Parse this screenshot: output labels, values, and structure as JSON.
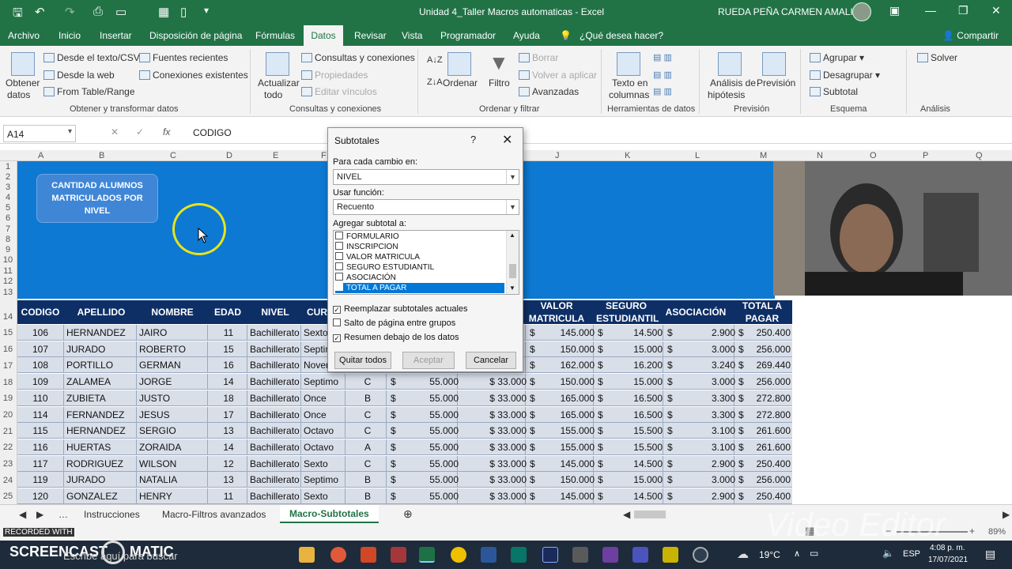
{
  "window": {
    "title": "Unidad 4_Taller Macros automaticas  -  Excel",
    "user": "RUEDA PEÑA CARMEN AMALIA"
  },
  "tabs": [
    "Archivo",
    "Inicio",
    "Insertar",
    "Disposición de página",
    "Fórmulas",
    "Datos",
    "Revisar",
    "Vista",
    "Programador",
    "Ayuda"
  ],
  "tell_me": "¿Qué desea hacer?",
  "share": "Compartir",
  "ribbon": {
    "obtener": "Obtener",
    "datos": "datos",
    "desde_texto": "Desde el texto/CSV",
    "desde_web": "Desde la web",
    "from_table": "From Table/Range",
    "fuentes": "Fuentes recientes",
    "conexiones_exist": "Conexiones existentes",
    "group1": "Obtener y transformar datos",
    "actualizar": "Actualizar",
    "todo": "todo",
    "consultas_con": "Consultas y conexiones",
    "propiedades": "Propiedades",
    "editar_vinculos": "Editar vínculos",
    "group2": "Consultas y conexiones",
    "ordenar": "Ordenar",
    "filtro": "Filtro",
    "borrar": "Borrar",
    "volver_aplicar": "Volver a aplicar",
    "avanzadas": "Avanzadas",
    "group3": "Ordenar y filtrar",
    "texto_en": "Texto en",
    "columnas": "columnas",
    "group4": "Herramientas de datos",
    "analisis": "Análisis de",
    "hipotesis": "hipótesis",
    "prevision": "Previsión",
    "group5": "Previsión",
    "agrupar": "Agrupar",
    "desagrupar": "Desagrupar",
    "subtotal": "Subtotal",
    "group6": "Esquema",
    "solver": "Solver",
    "group7": "Análisis"
  },
  "formula": {
    "namebox": "A14",
    "fx": "fx",
    "value": "CODIGO"
  },
  "columns": [
    "A",
    "B",
    "C",
    "D",
    "E",
    "F",
    "J",
    "K",
    "L",
    "M",
    "N",
    "O",
    "P",
    "Q"
  ],
  "rows_hdr": [
    "1",
    "2",
    "3",
    "4",
    "5",
    "6",
    "7",
    "8",
    "9",
    "10",
    "11",
    "12",
    "13",
    "14",
    "15",
    "16",
    "17",
    "18",
    "19",
    "20",
    "21",
    "22",
    "23",
    "24",
    "25"
  ],
  "banner": [
    "CANTIDAD ALUMNOS",
    "MATRICULADOS POR",
    "NIVEL"
  ],
  "table": {
    "headers": {
      "codigo": "CODIGO",
      "apellido": "APELLIDO",
      "nombre": "NOMBRE",
      "edad": "EDAD",
      "nivel": "NIVEL",
      "curso": "CUR",
      "valor1": "VALOR",
      "valor2": "MATRICULA",
      "seguro1": "SEGURO",
      "seguro2": "ESTUDIANTIL",
      "asociacion": "ASOCIACIÓN",
      "total1": "TOTAL A",
      "total2": "PAGAR"
    },
    "rows": [
      [
        "106",
        "HERNANDEZ",
        "JAIRO",
        "11",
        "Bachillerato",
        "Sexto",
        "",
        "",
        "",
        "",
        "145.000",
        "14.500",
        "2.900",
        "250.400"
      ],
      [
        "107",
        "JURADO",
        "ROBERTO",
        "15",
        "Bachillerato",
        "Septim",
        "",
        "",
        "",
        "",
        "150.000",
        "15.000",
        "3.000",
        "256.000"
      ],
      [
        "108",
        "PORTILLO",
        "GERMAN",
        "16",
        "Bachillerato",
        "Noven",
        "",
        "",
        "",
        "",
        "162.000",
        "16.200",
        "3.240",
        "269.440"
      ],
      [
        "109",
        "ZALAMEA",
        "JORGE",
        "14",
        "Bachillerato",
        "Septimo",
        "C",
        "$",
        "55.000",
        "$  33.000",
        "150.000",
        "15.000",
        "3.000",
        "256.000"
      ],
      [
        "110",
        "ZUBIETA",
        "JUSTO",
        "18",
        "Bachillerato",
        "Once",
        "B",
        "$",
        "55.000",
        "$  33.000",
        "165.000",
        "16.500",
        "3.300",
        "272.800"
      ],
      [
        "114",
        "FERNANDEZ",
        "JESUS",
        "17",
        "Bachillerato",
        "Once",
        "C",
        "$",
        "55.000",
        "$  33.000",
        "165.000",
        "16.500",
        "3.300",
        "272.800"
      ],
      [
        "115",
        "HERNANDEZ",
        "SERGIO",
        "13",
        "Bachillerato",
        "Octavo",
        "C",
        "$",
        "55.000",
        "$  33.000",
        "155.000",
        "15.500",
        "3.100",
        "261.600"
      ],
      [
        "116",
        "HUERTAS",
        "ZORAIDA",
        "14",
        "Bachillerato",
        "Octavo",
        "A",
        "$",
        "55.000",
        "$  33.000",
        "155.000",
        "15.500",
        "3.100",
        "261.600"
      ],
      [
        "117",
        "RODRIGUEZ",
        "WILSON",
        "12",
        "Bachillerato",
        "Sexto",
        "C",
        "$",
        "55.000",
        "$  33.000",
        "145.000",
        "14.500",
        "2.900",
        "250.400"
      ],
      [
        "119",
        "JURADO",
        "NATALIA",
        "13",
        "Bachillerato",
        "Septimo",
        "B",
        "$",
        "55.000",
        "$  33.000",
        "150.000",
        "15.000",
        "3.000",
        "256.000"
      ],
      [
        "120",
        "GONZALEZ",
        "HENRY",
        "11",
        "Bachillerato",
        "Sexto",
        "B",
        "$",
        "55.000",
        "$  33.000",
        "145.000",
        "14.500",
        "2.900",
        "250.400"
      ]
    ]
  },
  "dialog": {
    "title": "Subtotales",
    "help": "?",
    "close": "✕",
    "label_cambio": "Para cada cambio en:",
    "cambio_value": "NIVEL",
    "label_funcion": "Usar función:",
    "funcion_value": "Recuento",
    "label_agregar": "Agregar subtotal a:",
    "list": [
      "FORMULARIO",
      "INSCRIPCION",
      "VALOR MATRICULA",
      "SEGURO ESTUDIANTIL",
      "ASOCIACIÓN",
      "TOTAL A PAGAR"
    ],
    "opt_reemplazar": "Reemplazar subtotales actuales",
    "opt_salto": "Salto de página entre grupos",
    "opt_resumen": "Resumen debajo de los datos",
    "btn_quitar": "Quitar todos",
    "btn_aceptar": "Aceptar",
    "btn_cancelar": "Cancelar"
  },
  "sheets": [
    "Instrucciones",
    "Macro-Filtros avanzados",
    "Macro-Subtotales"
  ],
  "status": {
    "recorded": "RECORDED WITH",
    "brand": "SCREENCAST",
    "brand2": "MATIC",
    "search": "Escribe aquí para buscar",
    "zoom": "89%",
    "watermark": "Video Editor"
  },
  "taskbar": {
    "temp": "19°C",
    "lang": "ESP",
    "time": "4:08 p. m.",
    "date": "17/07/2021"
  }
}
